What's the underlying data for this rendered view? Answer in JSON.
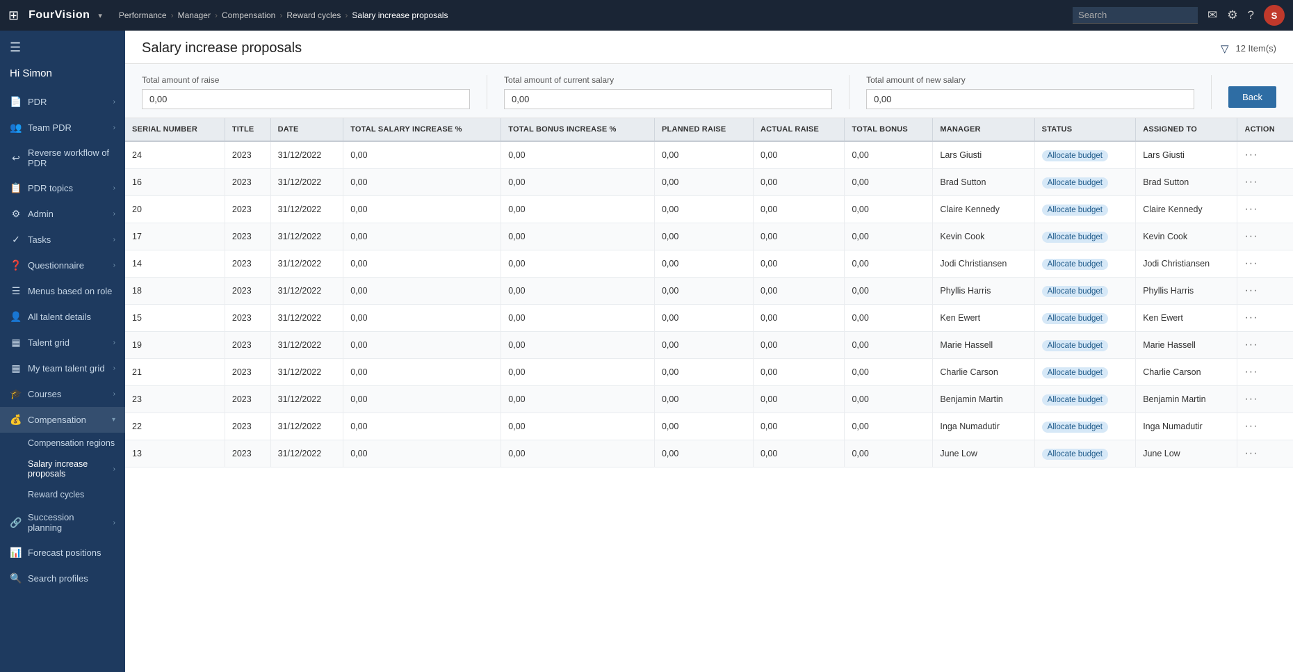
{
  "topnav": {
    "brand": "FourVision",
    "breadcrumbs": [
      "Performance",
      "Manager",
      "Compensation",
      "Reward cycles",
      "Salary increase proposals"
    ],
    "search_placeholder": "Search",
    "avatar_initials": "S"
  },
  "sidebar": {
    "greeting": "Hi Simon",
    "items": [
      {
        "id": "pdr",
        "label": "PDR",
        "icon": "📄",
        "has_chevron": true
      },
      {
        "id": "team-pdr",
        "label": "Team PDR",
        "icon": "👥",
        "has_chevron": true
      },
      {
        "id": "reverse-workflow",
        "label": "Reverse workflow of PDR",
        "icon": "↩",
        "has_chevron": false
      },
      {
        "id": "pdr-topics",
        "label": "PDR topics",
        "icon": "📋",
        "has_chevron": true
      },
      {
        "id": "admin",
        "label": "Admin",
        "icon": "⚙",
        "has_chevron": true
      },
      {
        "id": "tasks",
        "label": "Tasks",
        "icon": "✓",
        "has_chevron": true
      },
      {
        "id": "questionnaire",
        "label": "Questionnaire",
        "icon": "❓",
        "has_chevron": true
      },
      {
        "id": "menus-based-on-role",
        "label": "Menus based on role",
        "icon": "☰",
        "has_chevron": false
      },
      {
        "id": "all-talent-details",
        "label": "All talent details",
        "icon": "👤",
        "has_chevron": false
      },
      {
        "id": "talent-grid",
        "label": "Talent grid",
        "icon": "▦",
        "has_chevron": true
      },
      {
        "id": "my-team-talent-grid",
        "label": "My team talent grid",
        "icon": "▦",
        "has_chevron": true
      },
      {
        "id": "courses",
        "label": "Courses",
        "icon": "🎓",
        "has_chevron": true
      },
      {
        "id": "compensation",
        "label": "Compensation",
        "icon": "💰",
        "has_chevron": true,
        "expanded": true
      }
    ],
    "compensation_sub": [
      {
        "id": "compensation-regions",
        "label": "Compensation regions",
        "active": false
      },
      {
        "id": "salary-increase-proposals",
        "label": "Salary increase proposals",
        "active": true
      },
      {
        "id": "reward-cycles",
        "label": "Reward cycles",
        "active": false
      }
    ],
    "bottom_items": [
      {
        "id": "succession-planning",
        "label": "Succession planning",
        "icon": "🔗",
        "has_chevron": true
      },
      {
        "id": "forecast-positions",
        "label": "Forecast positions",
        "icon": "📊",
        "has_chevron": false
      },
      {
        "id": "search-profiles",
        "label": "Search profiles",
        "icon": "🔍",
        "has_chevron": false
      }
    ]
  },
  "page": {
    "title": "Salary increase proposals",
    "item_count": "12 Item(s)"
  },
  "summary": {
    "raise_label": "Total amount of raise",
    "raise_value": "0,00",
    "current_salary_label": "Total amount of current salary",
    "current_salary_value": "0,00",
    "new_salary_label": "Total amount of new salary",
    "new_salary_value": "0,00",
    "back_button": "Back"
  },
  "table": {
    "columns": [
      "SERIAL NUMBER",
      "TITLE",
      "DATE",
      "TOTAL SALARY INCREASE %",
      "TOTAL BONUS INCREASE %",
      "PLANNED RAISE",
      "ACTUAL RAISE",
      "TOTAL BONUS",
      "MANAGER",
      "STATUS",
      "ASSIGNED TO",
      "ACTION"
    ],
    "rows": [
      {
        "serial": "24",
        "title": "2023",
        "date": "31/12/2022",
        "salary_inc": "0,00",
        "bonus_inc": "0,00",
        "planned_raise": "0,00",
        "actual_raise": "0,00",
        "total_bonus": "0,00",
        "manager": "Lars Giusti",
        "status": "Allocate budget",
        "assigned_to": "Lars Giusti"
      },
      {
        "serial": "16",
        "title": "2023",
        "date": "31/12/2022",
        "salary_inc": "0,00",
        "bonus_inc": "0,00",
        "planned_raise": "0,00",
        "actual_raise": "0,00",
        "total_bonus": "0,00",
        "manager": "Brad Sutton",
        "status": "Allocate budget",
        "assigned_to": "Brad Sutton"
      },
      {
        "serial": "20",
        "title": "2023",
        "date": "31/12/2022",
        "salary_inc": "0,00",
        "bonus_inc": "0,00",
        "planned_raise": "0,00",
        "actual_raise": "0,00",
        "total_bonus": "0,00",
        "manager": "Claire Kennedy",
        "status": "Allocate budget",
        "assigned_to": "Claire Kennedy"
      },
      {
        "serial": "17",
        "title": "2023",
        "date": "31/12/2022",
        "salary_inc": "0,00",
        "bonus_inc": "0,00",
        "planned_raise": "0,00",
        "actual_raise": "0,00",
        "total_bonus": "0,00",
        "manager": "Kevin Cook",
        "status": "Allocate budget",
        "assigned_to": "Kevin Cook"
      },
      {
        "serial": "14",
        "title": "2023",
        "date": "31/12/2022",
        "salary_inc": "0,00",
        "bonus_inc": "0,00",
        "planned_raise": "0,00",
        "actual_raise": "0,00",
        "total_bonus": "0,00",
        "manager": "Jodi Christiansen",
        "status": "Allocate budget",
        "assigned_to": "Jodi Christiansen"
      },
      {
        "serial": "18",
        "title": "2023",
        "date": "31/12/2022",
        "salary_inc": "0,00",
        "bonus_inc": "0,00",
        "planned_raise": "0,00",
        "actual_raise": "0,00",
        "total_bonus": "0,00",
        "manager": "Phyllis Harris",
        "status": "Allocate budget",
        "assigned_to": "Phyllis Harris"
      },
      {
        "serial": "15",
        "title": "2023",
        "date": "31/12/2022",
        "salary_inc": "0,00",
        "bonus_inc": "0,00",
        "planned_raise": "0,00",
        "actual_raise": "0,00",
        "total_bonus": "0,00",
        "manager": "Ken Ewert",
        "status": "Allocate budget",
        "assigned_to": "Ken Ewert"
      },
      {
        "serial": "19",
        "title": "2023",
        "date": "31/12/2022",
        "salary_inc": "0,00",
        "bonus_inc": "0,00",
        "planned_raise": "0,00",
        "actual_raise": "0,00",
        "total_bonus": "0,00",
        "manager": "Marie Hassell",
        "status": "Allocate budget",
        "assigned_to": "Marie Hassell"
      },
      {
        "serial": "21",
        "title": "2023",
        "date": "31/12/2022",
        "salary_inc": "0,00",
        "bonus_inc": "0,00",
        "planned_raise": "0,00",
        "actual_raise": "0,00",
        "total_bonus": "0,00",
        "manager": "Charlie Carson",
        "status": "Allocate budget",
        "assigned_to": "Charlie Carson"
      },
      {
        "serial": "23",
        "title": "2023",
        "date": "31/12/2022",
        "salary_inc": "0,00",
        "bonus_inc": "0,00",
        "planned_raise": "0,00",
        "actual_raise": "0,00",
        "total_bonus": "0,00",
        "manager": "Benjamin Martin",
        "status": "Allocate budget",
        "assigned_to": "Benjamin Martin"
      },
      {
        "serial": "22",
        "title": "2023",
        "date": "31/12/2022",
        "salary_inc": "0,00",
        "bonus_inc": "0,00",
        "planned_raise": "0,00",
        "actual_raise": "0,00",
        "total_bonus": "0,00",
        "manager": "Inga Numadutir",
        "status": "Allocate budget",
        "assigned_to": "Inga Numadutir"
      },
      {
        "serial": "13",
        "title": "2023",
        "date": "31/12/2022",
        "salary_inc": "0,00",
        "bonus_inc": "0,00",
        "planned_raise": "0,00",
        "actual_raise": "0,00",
        "total_bonus": "0,00",
        "manager": "June Low",
        "status": "Allocate budget",
        "assigned_to": "June Low"
      }
    ]
  }
}
